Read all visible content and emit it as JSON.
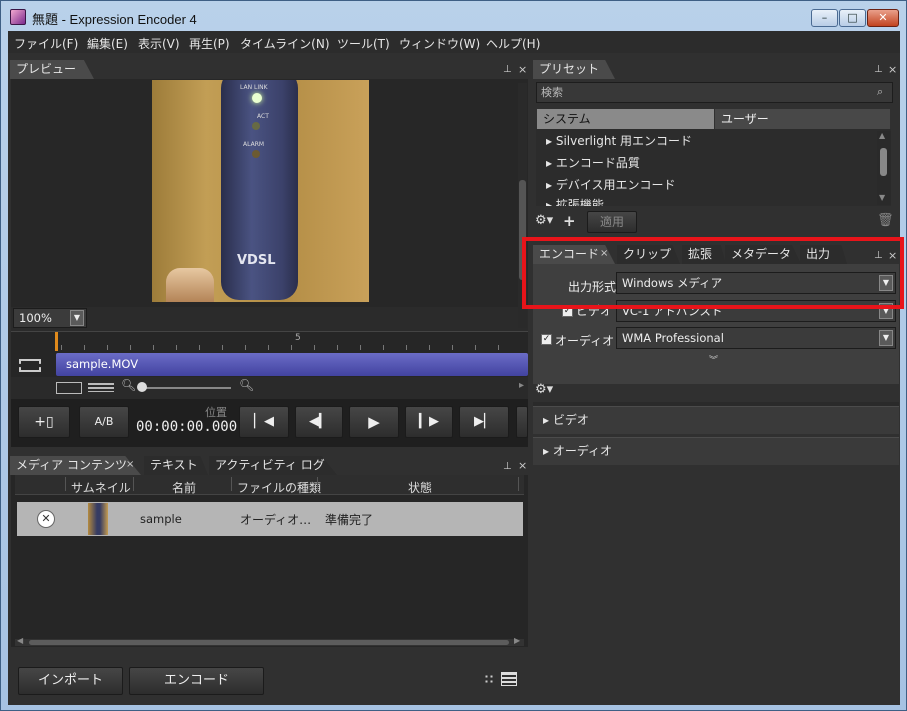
{
  "window": {
    "title": "無題 - Expression Encoder 4",
    "min": "–",
    "max": "□",
    "close": "✕"
  },
  "menu": [
    "ファイル(F)",
    "編集(E)",
    "表示(V)",
    "再生(P)",
    "タイムライン(N)",
    "ツール(T)",
    "ウィンドウ(W)",
    "ヘルプ(H)"
  ],
  "preview": {
    "tab": "プレビュー",
    "zoom": "100%",
    "video_labels": {
      "lan": "LAN LINK",
      "act": "ACT",
      "alarm": "ALARM",
      "brand": "VDSL"
    }
  },
  "timeline": {
    "clip": "sample.MOV",
    "tick_mark": "5"
  },
  "transport": {
    "ab": "A/B",
    "position_label": "位置",
    "timecode": "00:00:00.000"
  },
  "media": {
    "tabs": [
      "メディア コンテンツ",
      "テキスト",
      "アクティビティ ログ"
    ],
    "columns": [
      "サムネイル",
      "名前",
      "ファイルの種類",
      "状態"
    ],
    "rows": [
      {
        "name": "sample",
        "type": "オーディオ…",
        "status": "準備完了"
      }
    ],
    "import_button": "インポート",
    "encode_button": "エンコード"
  },
  "presets": {
    "tab": "プリセット",
    "search_placeholder": "検索",
    "tabs": [
      "システム",
      "ユーザー"
    ],
    "items": [
      "Silverlight 用エンコード",
      "エンコード品質",
      "デバイス用エンコード",
      "拡張機能"
    ],
    "apply_button": "適用"
  },
  "encode": {
    "tabs": [
      "エンコード",
      "クリップ",
      "拡張",
      "メタデータ",
      "出力"
    ],
    "output_format_label": "出力形式",
    "output_format_value": "Windows メディア",
    "video_label": "ビデオ",
    "video_value": "VC-1 アドバンスト",
    "audio_label": "オーディオ",
    "audio_value": "WMA Professional",
    "sections": [
      "ビデオ",
      "オーディオ"
    ]
  },
  "highlight_color": "#e8141a"
}
